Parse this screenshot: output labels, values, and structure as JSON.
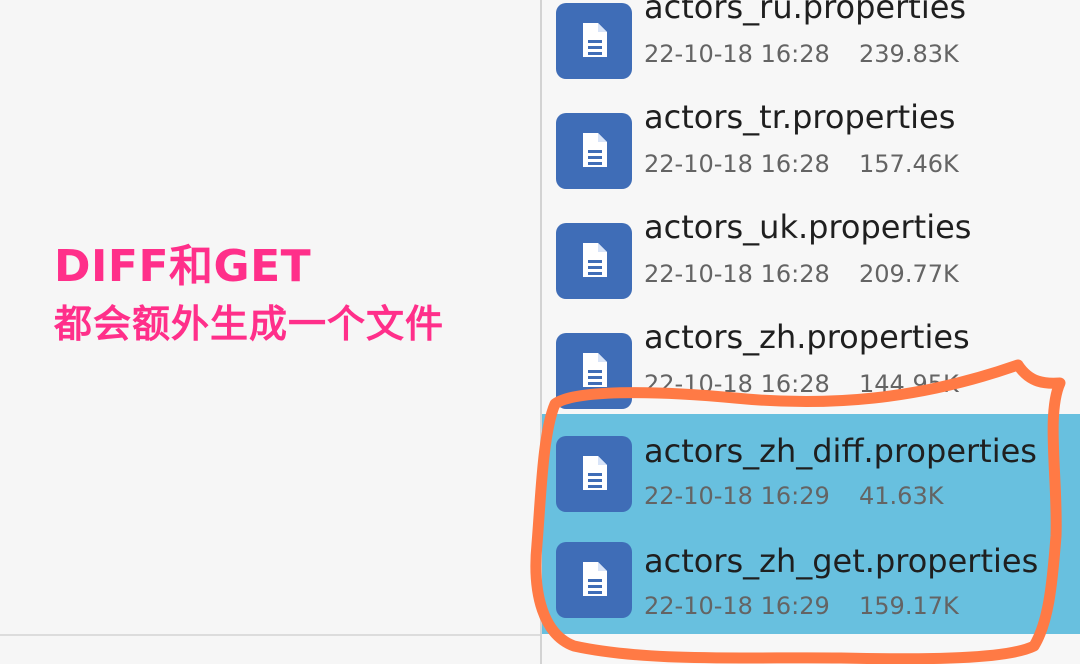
{
  "annotation": {
    "line1": "DIFF和GET",
    "line2": "都会额外生成一个文件"
  },
  "files": [
    {
      "name": "actors_ru.properties",
      "date": "22-10-18 16:28",
      "size": "239.83K",
      "selected": false,
      "icon": "document-icon"
    },
    {
      "name": "actors_tr.properties",
      "date": "22-10-18 16:28",
      "size": "157.46K",
      "selected": false,
      "icon": "document-icon"
    },
    {
      "name": "actors_uk.properties",
      "date": "22-10-18 16:28",
      "size": "209.77K",
      "selected": false,
      "icon": "document-icon"
    },
    {
      "name": "actors_zh.properties",
      "date": "22-10-18 16:28",
      "size": "144.95K",
      "selected": false,
      "icon": "document-icon"
    },
    {
      "name": "actors_zh_diff.properties",
      "date": "22-10-18 16:29",
      "size": "41.63K",
      "selected": true,
      "icon": "document-icon"
    },
    {
      "name": "actors_zh_get.properties",
      "date": "22-10-18 16:29",
      "size": "159.17K",
      "selected": true,
      "icon": "document-icon"
    }
  ],
  "colors": {
    "annotation": "#ff2f8a",
    "selection": "#68c0df",
    "file_icon": "#3f6db7",
    "highlight_stroke": "#ff7a45"
  }
}
